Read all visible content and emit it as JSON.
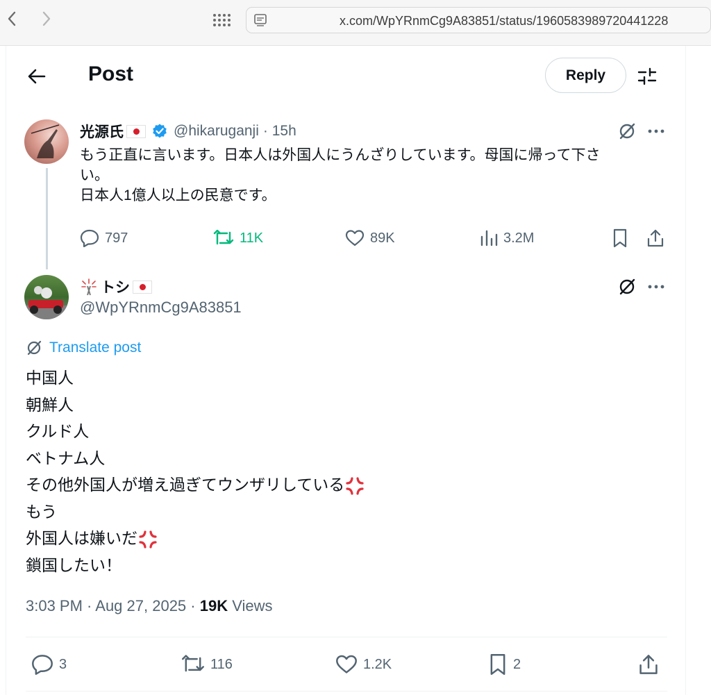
{
  "browser": {
    "url": "x.com/WpYRnmCg9A83851/status/1960583989720441228"
  },
  "header": {
    "title": "Post",
    "reply_label": "Reply"
  },
  "parent_post": {
    "display_name": "光源氏",
    "handle": "@hikaruganji",
    "time": "· 15h",
    "text_lines": [
      "もう正直に言います。日本人は外国人にうんざりしています。母国に帰って下さ",
      "い。",
      "日本人1億人以上の民意です。"
    ],
    "stats": {
      "replies": "797",
      "reposts": "11K",
      "likes": "89K",
      "views": "3.2M"
    }
  },
  "main_post": {
    "display_name": "トシ",
    "handle": "@WpYRnmCg9A83851",
    "translate_label": "Translate post",
    "lines": [
      "中国人",
      "朝鮮人",
      "クルド人",
      "ベトナム人",
      "その他外国人が増え過ぎてウンザリしている",
      "もう",
      "外国人は嫌いだ",
      "鎖国したい！"
    ],
    "timestamp": "3:03 PM · Aug 27, 2025 · ",
    "views_count": "19K",
    "views_label": " Views",
    "stats": {
      "replies": "3",
      "reposts": "116",
      "likes": "1.2K",
      "bookmarks": "2"
    }
  },
  "colors": {
    "accent": "#1d9bf0",
    "repost_active": "#00ba7c",
    "secondary_text": "#536471",
    "anger_emoji": "#e0323c"
  },
  "icons": [
    "back-arrow-icon",
    "forward-arrow-icon",
    "grid-icon",
    "page-icon",
    "settings-sliders-icon",
    "verified-badge-icon",
    "grok-icon",
    "more-icon",
    "reply-icon",
    "repost-icon",
    "like-icon",
    "views-icon",
    "bookmark-icon",
    "share-icon",
    "translate-icon",
    "anger-emoji-icon",
    "sparkler-icon"
  ]
}
